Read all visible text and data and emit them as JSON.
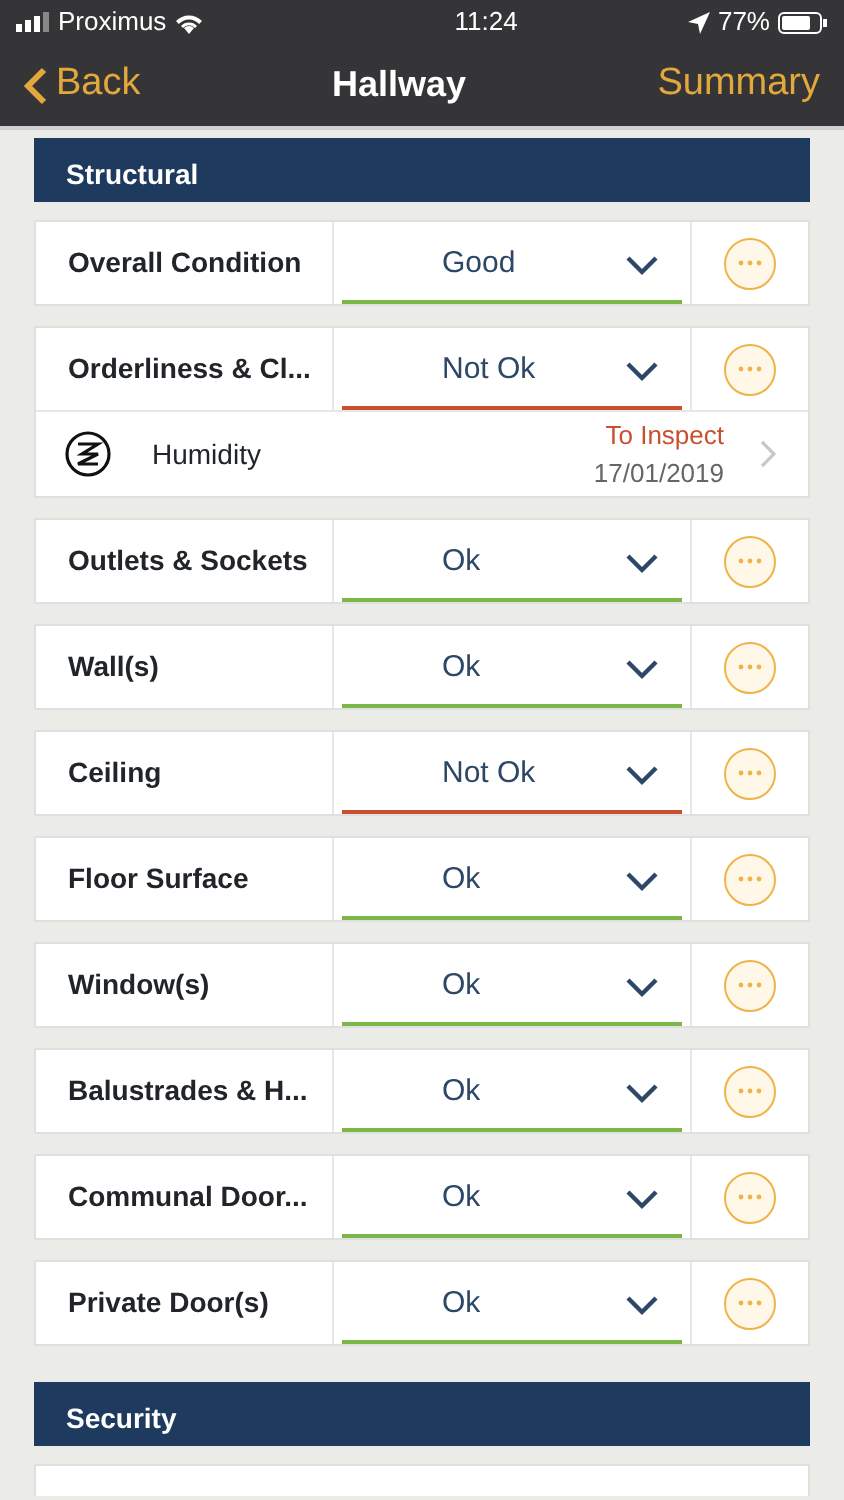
{
  "status_bar": {
    "carrier": "Proximus",
    "time": "11:24",
    "battery": "77%"
  },
  "nav": {
    "back": "Back",
    "title": "Hallway",
    "action": "Summary"
  },
  "sections": [
    {
      "title": "Structural",
      "items": [
        {
          "label": "Overall Condition",
          "value": "Good",
          "kind": "ok"
        },
        {
          "label": "Orderliness & Cl...",
          "value": "Not Ok",
          "kind": "bad",
          "sub": {
            "label": "Humidity",
            "state": "To Inspect",
            "date": "17/01/2019"
          }
        },
        {
          "label": "Outlets & Sockets",
          "value": "Ok",
          "kind": "ok"
        },
        {
          "label": "Wall(s)",
          "value": "Ok",
          "kind": "ok"
        },
        {
          "label": "Ceiling",
          "value": "Not Ok",
          "kind": "bad"
        },
        {
          "label": "Floor Surface",
          "value": "Ok",
          "kind": "ok"
        },
        {
          "label": "Window(s)",
          "value": "Ok",
          "kind": "ok"
        },
        {
          "label": "Balustrades & H...",
          "value": "Ok",
          "kind": "ok"
        },
        {
          "label": "Communal Door...",
          "value": "Ok",
          "kind": "ok"
        },
        {
          "label": "Private Door(s)",
          "value": "Ok",
          "kind": "ok"
        }
      ]
    },
    {
      "title": "Security",
      "items": [
        {
          "kind": "cut"
        }
      ]
    }
  ]
}
